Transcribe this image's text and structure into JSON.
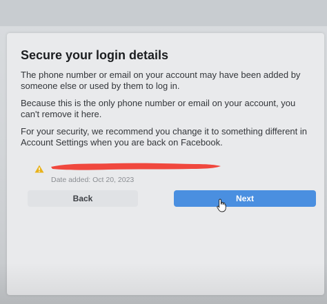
{
  "dialog": {
    "title": "Secure your login details",
    "paragraphs": [
      "The phone number or email on your account may have been added by someone else or used by them to log in.",
      "Because this is the only phone number or email on your account, you can't remove it here.",
      "For your security, we recommend you change it to something different in Account Settings when you are back on Facebook."
    ],
    "contact": {
      "value": "",
      "date_added": "Date added: Oct 20, 2023"
    },
    "buttons": {
      "back_label": "Back",
      "next_label": "Next"
    }
  },
  "icons": {
    "warning": "warning-icon",
    "cursor": "hand-cursor-icon"
  },
  "colors": {
    "primary_button": "#4a8fe0",
    "secondary_button": "#e0e2e5",
    "warning": "#e8b21c",
    "redaction": "#f0483e"
  }
}
